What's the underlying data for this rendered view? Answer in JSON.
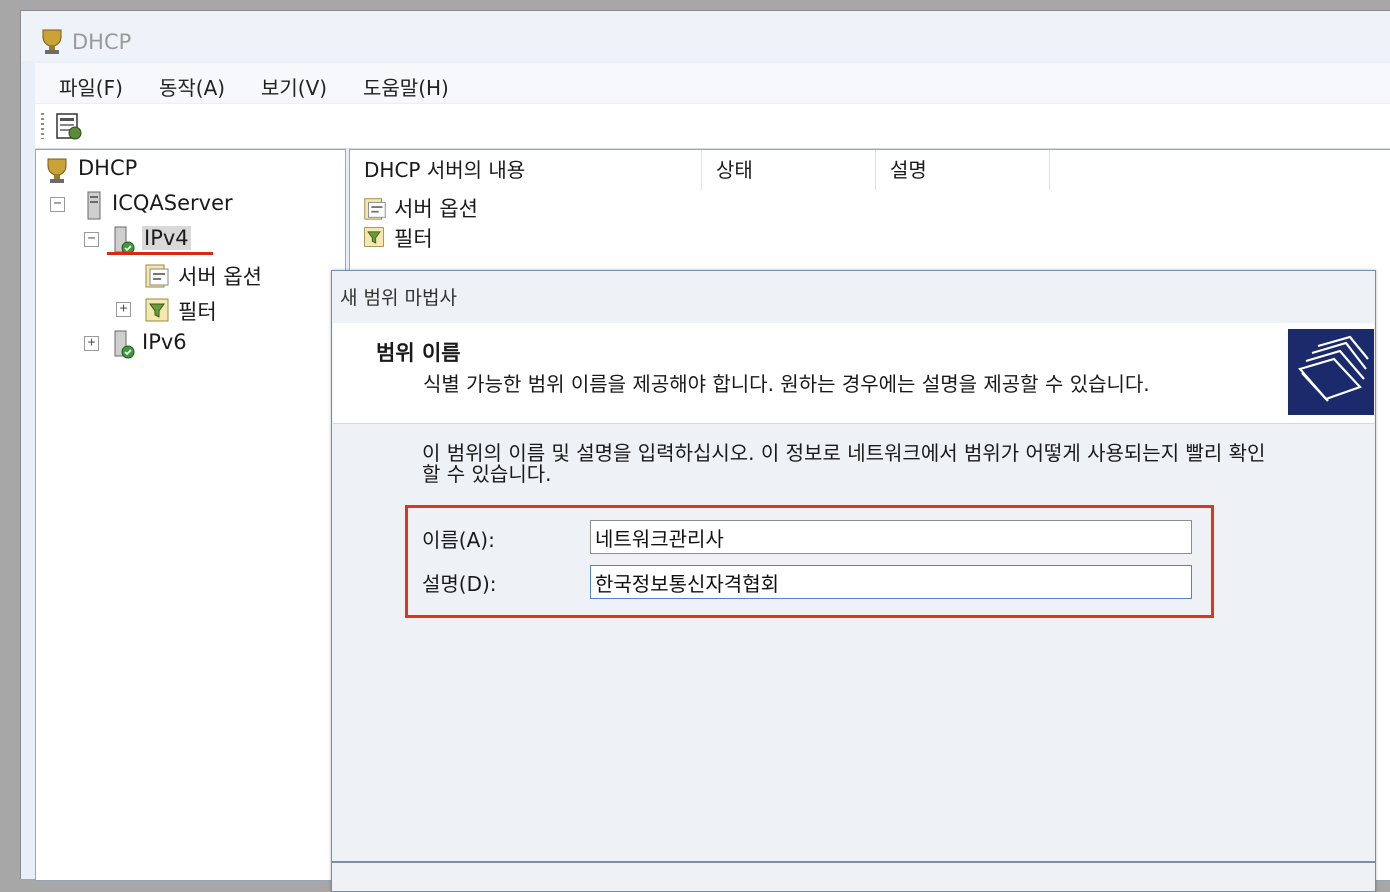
{
  "window": {
    "title": "DHCP"
  },
  "menu": [
    "파일(F)",
    "동작(A)",
    "보기(V)",
    "도움말(H)"
  ],
  "tree": {
    "root": "DHCP",
    "server": "ICQAServer",
    "ipv4": "IPv4",
    "server_options": "서버 옵션",
    "filters": "필터",
    "ipv6": "IPv6",
    "expand_symbol": "+",
    "collapse_symbol": "−"
  },
  "list": {
    "columns": [
      "DHCP 서버의 내용",
      "상태",
      "설명"
    ],
    "rows": [
      "서버 옵션",
      "필터"
    ]
  },
  "wizard": {
    "title": "새 범위 마법사",
    "heading": "범위 이름",
    "subheading": "식별 가능한 범위 이름을 제공해야 합니다. 원하는 경우에는 설명을 제공할 수 있습니다.",
    "instructions": "이 범위의 이름 및 설명을 입력하십시오. 이 정보로 네트워크에서 범위가 어떻게 사용되는지 빨리 확인할 수 있습니다.",
    "name_label": "이름(A):",
    "name_value": "네트워크관리사",
    "desc_label": "설명(D):",
    "desc_value": "한국정보통신자격협회"
  },
  "colors": {
    "highlight": "#d9381e",
    "wizard_banner": "#1a2a6b"
  }
}
